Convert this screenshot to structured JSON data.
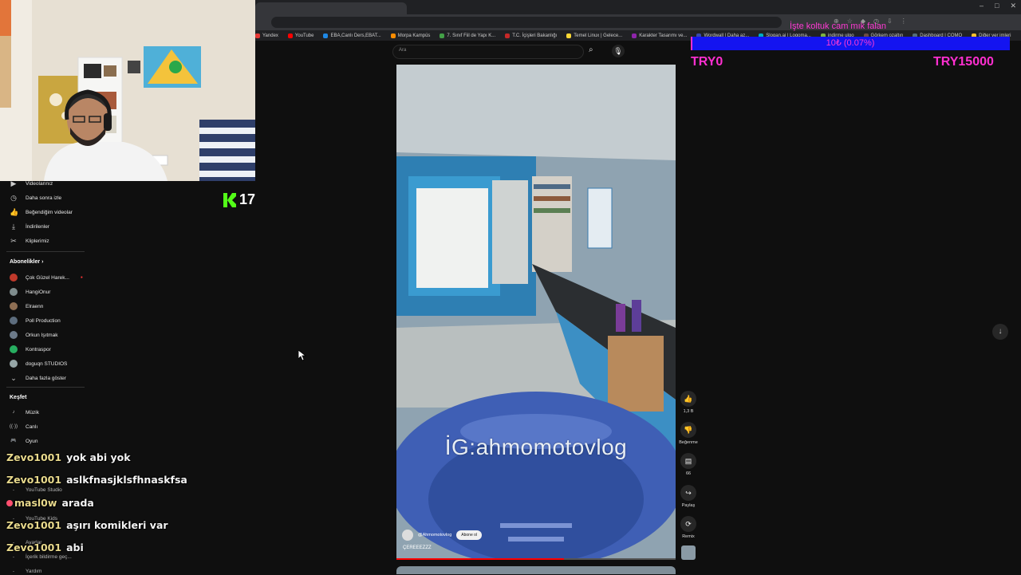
{
  "browser": {
    "bookmarks": [
      "Yandex",
      "YouTube",
      "EBA,Canlı Ders,EBAT...",
      "Morpa Kampüs",
      "7. Sınıf Fiil de Yapı K...",
      "T.C. İçişleri Bakanlığı",
      "Temel Linux | Gelece...",
      "Karakter Tasarımı ve...",
      "Wordwall | Daha az...",
      "Slogan.ai | Logoma...",
      "indirme ulgo",
      "Görkem ozaltın",
      "Dashboard | COMO",
      "Diğer yer imleri"
    ],
    "bookmark_colors": [
      "#e53935",
      "#ff0000",
      "#1e88e5",
      "#fb8c00",
      "#43a047",
      "#c62828",
      "#fdd835",
      "#8e24aa",
      "#3949ab",
      "#00acc1",
      "#7cb342",
      "#6d4c41",
      "#546e7a",
      "#fbc02d"
    ]
  },
  "stream_overlay": {
    "kick_count": "17",
    "goal_title": "İşte koltuk cam mık falan",
    "goal_progress": "10₺ (0.07%)",
    "goal_min": "TRY0",
    "goal_max": "TRY15000",
    "goal_fraction": 0.0007,
    "goal_bar_color": "#1414f0",
    "goal_text_color": "#ff2fd0"
  },
  "sidebar": {
    "top_items": [
      {
        "icon": "video-icon",
        "label": "Videolarınız"
      },
      {
        "icon": "clock-icon",
        "label": "Daha sonra izle"
      },
      {
        "icon": "thumb-up-icon",
        "label": "Beğendiğim videolar"
      },
      {
        "icon": "download-icon",
        "label": "İndirilenler"
      },
      {
        "icon": "scissors-icon",
        "label": "Kliplerimiz"
      }
    ],
    "subscriptions_heading": "Abonelikler",
    "subscriptions": [
      {
        "label": "Çok Güzel Harek...",
        "live": true
      },
      {
        "label": "HangiOnur",
        "live": false
      },
      {
        "label": "Elraenn",
        "live": false
      },
      {
        "label": "Poll Production",
        "live": false
      },
      {
        "label": "Orkun Işıtmak",
        "live": false
      },
      {
        "label": "Kontraspor",
        "live": false
      },
      {
        "label": "doguqn STUDIOS",
        "live": false
      }
    ],
    "show_more": "Daha fazla göster",
    "explore_heading": "Keşfet",
    "explore": [
      {
        "icon": "music-icon",
        "label": "Müzik"
      },
      {
        "icon": "live-icon",
        "label": "Canlı"
      },
      {
        "icon": "gamepad-icon",
        "label": "Oyun"
      }
    ],
    "more_items": [
      "YouTube Studio",
      "YouTube Kids",
      "Ayarlar",
      "İçerik bildirme geç...",
      "Yardım"
    ]
  },
  "search": {
    "placeholder": "Ara"
  },
  "short": {
    "caption": "İG:ahmomotovlog",
    "channel": "@Ahmomotovlog",
    "subscribe": "Abone ol",
    "title": "ÇEREEEZZZ",
    "progress": 0.6
  },
  "actions": {
    "likes": "1,3 B",
    "dislike": "Beğenme",
    "comments": "66",
    "share": "Paylaş",
    "remix": "Remix"
  },
  "chat": [
    {
      "user": "Zevo1001",
      "msg": "yok abi yok",
      "badge": false
    },
    {
      "user": "Zevo1001",
      "msg": "aslkfnasjklsfhnaskfsa",
      "badge": false
    },
    {
      "user": "masl0w",
      "msg": "arada",
      "badge": true
    },
    {
      "user": "Zevo1001",
      "msg": "aşırı komikleri var",
      "badge": false
    },
    {
      "user": "Zevo1001",
      "msg": "abi",
      "badge": false
    }
  ]
}
